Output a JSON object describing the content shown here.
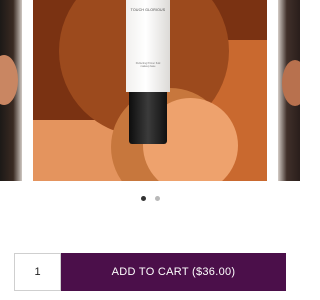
{
  "carousel": {
    "product_image": {
      "brand_text": "TOUCH GLORIOUS",
      "fine_print": "Perfecting Primer fluid makeup base"
    },
    "dots": [
      {
        "label": "slide-1",
        "active": true
      },
      {
        "label": "slide-2",
        "active": false
      }
    ]
  },
  "purchase": {
    "quantity": "1",
    "add_to_cart_label": "ADD TO CART ($36.00)"
  },
  "colors": {
    "button_bg": "#4b0f4a",
    "image_bg": "#e4945e"
  }
}
